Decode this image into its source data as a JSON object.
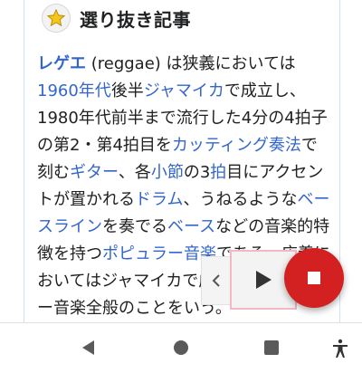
{
  "header": {
    "title": "選り抜き記事",
    "badge_icon": "star-icon"
  },
  "article": {
    "segments": [
      {
        "text": "レゲエ",
        "type": "link-bold"
      },
      {
        "text": " (reggae) は狭義においては",
        "type": "text"
      },
      {
        "text": "1960年代",
        "type": "link"
      },
      {
        "text": "後半",
        "type": "text"
      },
      {
        "text": "ジャマイカ",
        "type": "link"
      },
      {
        "text": "で成立し、1980年代前半まで流行した4分の4拍子の第2・第4拍目を",
        "type": "text"
      },
      {
        "text": "カッティング奏法",
        "type": "link"
      },
      {
        "text": "で刻む",
        "type": "text"
      },
      {
        "text": "ギター",
        "type": "link"
      },
      {
        "text": "、各",
        "type": "text"
      },
      {
        "text": "小節",
        "type": "link"
      },
      {
        "text": "の3",
        "type": "text"
      },
      {
        "text": "拍",
        "type": "link"
      },
      {
        "text": "目にアクセントが置かれる",
        "type": "text"
      },
      {
        "text": "ドラム",
        "type": "link"
      },
      {
        "text": "、うねるような",
        "type": "text"
      },
      {
        "text": "ベースライン",
        "type": "link"
      },
      {
        "text": "を奏でる",
        "type": "text"
      },
      {
        "text": "ベース",
        "type": "link"
      },
      {
        "text": "などの音楽的特徴を持つ",
        "type": "text"
      },
      {
        "text": "ポピュラー音楽",
        "type": "link"
      },
      {
        "text": "である。広義においてはジャマイカで成立したポピュラー音楽全般のことをいう。",
        "type": "text"
      }
    ]
  },
  "player": {
    "prev_icon": "chevron-left-icon",
    "play_icon": "play-icon",
    "stop_icon": "stop-icon"
  },
  "navbar": {
    "back_icon": "back-triangle-icon",
    "home_icon": "home-circle-icon",
    "recents_icon": "recents-square-icon",
    "accessibility_icon": "accessibility-icon"
  },
  "colors": {
    "link": "#3366cc",
    "text": "#202122",
    "stop_fab": "#d32020",
    "play_border": "#f3b8c4"
  }
}
